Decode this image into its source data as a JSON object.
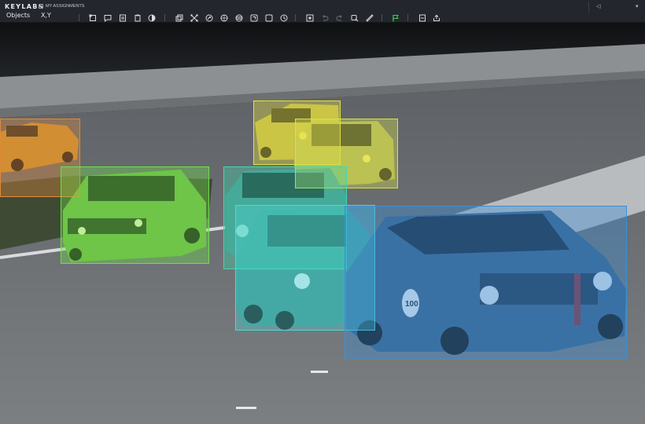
{
  "app": {
    "logo": "KEYLABS",
    "breadcrumb": "MY ASSIGNMENTS"
  },
  "nav": {
    "objects_tab": "Objects",
    "xy_tab": "X,Y"
  },
  "toolbar": {
    "tools": [
      {
        "name": "polygon-tool-icon"
      },
      {
        "name": "comment-tool-icon"
      },
      {
        "name": "document-tool-icon"
      },
      {
        "name": "clipboard-tool-icon"
      },
      {
        "name": "contrast-tool-icon"
      },
      {
        "name": "copy-tool-icon"
      },
      {
        "name": "keypoints-tool-icon"
      },
      {
        "name": "magic-tool-icon"
      },
      {
        "name": "grid-tool-icon"
      },
      {
        "name": "layers-tool-icon"
      },
      {
        "name": "frame-tool-icon"
      },
      {
        "name": "history-tool-icon"
      },
      {
        "name": "add-frame-icon"
      },
      {
        "name": "undo-icon"
      },
      {
        "name": "redo-icon"
      },
      {
        "name": "ai-assist-icon"
      },
      {
        "name": "measure-icon"
      },
      {
        "name": "flag-icon"
      },
      {
        "name": "export-icon"
      },
      {
        "name": "share-icon"
      }
    ]
  },
  "annotations": [
    {
      "label": "car-orange",
      "color": "#e0893a"
    },
    {
      "label": "car-yellow-1",
      "color": "#e7e042"
    },
    {
      "label": "car-yellow-2",
      "color": "#d9e04a"
    },
    {
      "label": "car-green",
      "color": "#6fe04a"
    },
    {
      "label": "car-teal",
      "color": "#3fd8b0"
    },
    {
      "label": "car-cyan",
      "color": "#4fd6d8"
    },
    {
      "label": "car-blue",
      "color": "#3a8fd8"
    }
  ]
}
